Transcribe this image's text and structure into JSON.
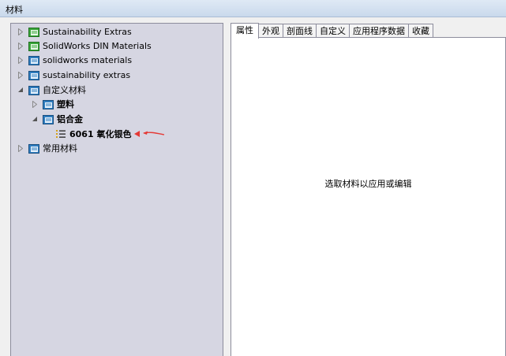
{
  "window": {
    "title": "材料"
  },
  "tree": {
    "items": [
      {
        "label": "Sustainability Extras"
      },
      {
        "label": "SolidWorks DIN Materials"
      },
      {
        "label": "solidworks materials"
      },
      {
        "label": "sustainability extras"
      },
      {
        "label": "自定义材料"
      },
      {
        "label": "塑料"
      },
      {
        "label": "铝合金"
      },
      {
        "label": "6061 氧化银色"
      },
      {
        "label": "常用材料"
      }
    ]
  },
  "tabs": [
    {
      "label": "属性"
    },
    {
      "label": "外观"
    },
    {
      "label": "剖面线"
    },
    {
      "label": "自定义"
    },
    {
      "label": "应用程序数据"
    },
    {
      "label": "收藏"
    }
  ],
  "content": {
    "hint": "选取材料以应用或编辑"
  },
  "colors": {
    "folder_green": "#3aa63a",
    "folder_blue": "#2f7dbf",
    "annotation_red": "#e53935",
    "tree_bg": "#d6d6e2"
  }
}
